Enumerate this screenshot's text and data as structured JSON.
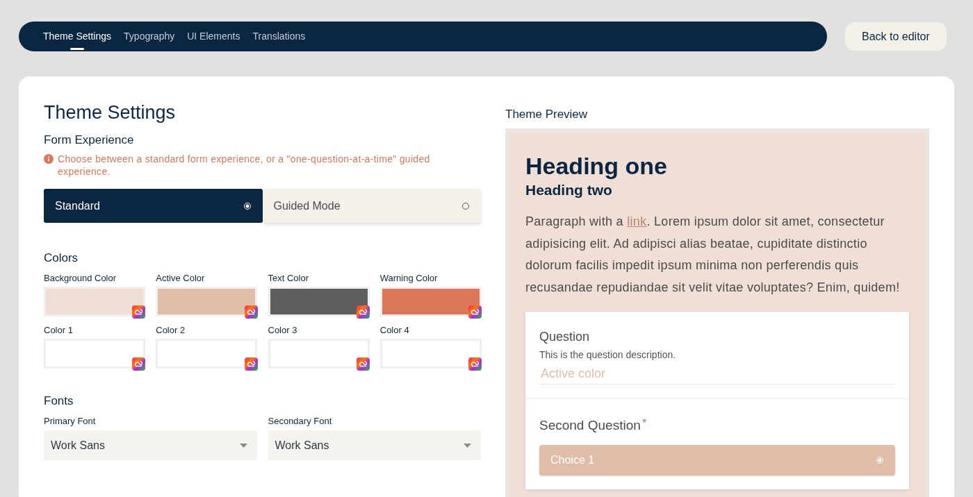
{
  "nav": {
    "tabs": [
      {
        "label": "Theme Settings",
        "selected": true
      },
      {
        "label": "Typography",
        "selected": false
      },
      {
        "label": "UI Elements",
        "selected": false
      },
      {
        "label": "Translations",
        "selected": false
      }
    ],
    "back_button": "Back to editor"
  },
  "settings": {
    "title": "Theme Settings",
    "form_experience": {
      "heading": "Form Experience",
      "notice": "Choose between a standard form experience, or a \"one-question-at-a-time\" guided experience.",
      "options": [
        {
          "label": "Standard",
          "selected": true
        },
        {
          "label": "Guided Mode",
          "selected": false
        }
      ]
    },
    "colors": {
      "heading": "Colors",
      "swatches": [
        {
          "label": "Background Color",
          "color": "#efdfd6"
        },
        {
          "label": "Active Color",
          "color": "#e0bda9"
        },
        {
          "label": "Text Color",
          "color": "#5f5f5f"
        },
        {
          "label": "Warning Color",
          "color": "#db7659"
        },
        {
          "label": "Color 1"
        },
        {
          "label": "Color 2"
        },
        {
          "label": "Color 3"
        },
        {
          "label": "Color 4"
        }
      ]
    },
    "fonts": {
      "heading": "Fonts",
      "selects": [
        {
          "label": "Primary Font",
          "value": "Work Sans"
        },
        {
          "label": "Secondary Font",
          "value": "Work Sans"
        }
      ]
    }
  },
  "preview": {
    "title": "Theme Preview",
    "heading_one": "Heading one",
    "heading_two": "Heading two",
    "paragraph": {
      "before": "Paragraph with a ",
      "link": "link",
      "after": ". Lorem ipsum dolor sit amet, consectetur adipisicing elit. Ad adipisci alias beatae, cupiditate distinctio dolorum facilis impedit ipsum minima non perferendis quis recusandae repudiandae sit velit vitae voluptates? Enim, quidem!"
    },
    "question": {
      "label": "Question",
      "description": "This is the question description.",
      "placeholder": "Active color"
    },
    "second_question": {
      "label": "Second Question",
      "required_mark": "*",
      "choices": [
        {
          "label": "Choice 1",
          "selected": true
        }
      ]
    }
  }
}
